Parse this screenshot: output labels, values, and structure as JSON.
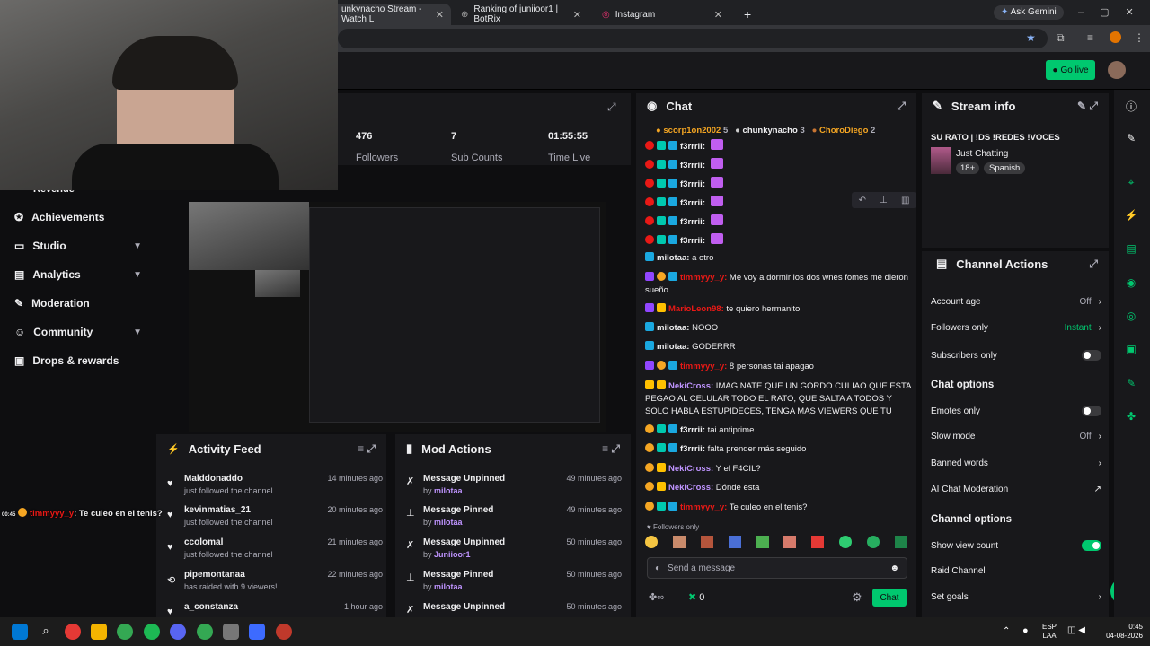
{
  "browser": {
    "tabs": [
      {
        "label": "unkynacho Stream - Watch L"
      },
      {
        "label": "Ranking of juniioor1 | BotRix"
      },
      {
        "label": "Instagram"
      }
    ],
    "new_tab": "+",
    "gemini": "Ask Gemini"
  },
  "topbar": {
    "go_live": "Go live"
  },
  "stats": [
    {
      "value": "476",
      "label": "Followers"
    },
    {
      "value": "7",
      "label": "Sub Counts"
    },
    {
      "value": "01:55:55",
      "label": "Time Live"
    }
  ],
  "sidebar": {
    "partial": "Revenue",
    "items": [
      {
        "label": "Achievements"
      },
      {
        "label": "Studio",
        "chev": "▼"
      },
      {
        "label": "Analytics",
        "chev": "▼"
      },
      {
        "label": "Moderation"
      },
      {
        "label": "Community",
        "chev": "▼"
      },
      {
        "label": "Drops & rewards"
      }
    ]
  },
  "activity": {
    "title": "Activity Feed",
    "items": [
      {
        "name": "Malddonaddo",
        "sub": "just followed the channel",
        "time": "14 minutes ago"
      },
      {
        "name": "kevinmatias_21",
        "sub": "just followed the channel",
        "time": "20 minutes ago"
      },
      {
        "name": "ccolomal",
        "sub": "just followed the channel",
        "time": "21 minutes ago"
      },
      {
        "name": "pipemontanaa",
        "sub": "has raided with 9 viewers!",
        "time": "22 minutes ago"
      },
      {
        "name": "a_constanza",
        "sub": "",
        "time": "1 hour ago"
      }
    ]
  },
  "overlay_chat": {
    "time": "00:45",
    "user": "timmyyy_y",
    "text": ": Te culeo en el tenis?"
  },
  "mod_actions": {
    "title": "Mod Actions",
    "by": "by",
    "items": [
      {
        "action": "Message Unpinned",
        "user": "milotaa",
        "time": "49 minutes ago"
      },
      {
        "action": "Message Pinned",
        "user": "milotaa",
        "time": "49 minutes ago"
      },
      {
        "action": "Message Unpinned",
        "user": "Juniioor1",
        "time": "50 minutes ago"
      },
      {
        "action": "Message Pinned",
        "user": "milotaa",
        "time": "50 minutes ago"
      },
      {
        "action": "Message Unpinned",
        "user": "",
        "time": "50 minutes ago"
      }
    ]
  },
  "chat": {
    "title": "Chat",
    "top_gifters": [
      {
        "name": "scorp1on2002",
        "n": "5"
      },
      {
        "name": "chunkynacho",
        "n": "3"
      },
      {
        "name": "ChoroDiego",
        "n": "2"
      }
    ],
    "messages": [
      {
        "user": "f3rrrii:",
        "text": "",
        "color": "#efeff1"
      },
      {
        "user": "f3rrrii:",
        "text": "",
        "color": "#efeff1"
      },
      {
        "user": "f3rrrii:",
        "text": "",
        "color": "#efeff1"
      },
      {
        "user": "f3rrrii:",
        "text": "",
        "color": "#efeff1"
      },
      {
        "user": "f3rrrii:",
        "text": "",
        "color": "#efeff1"
      },
      {
        "user": "f3rrrii:",
        "text": "",
        "color": "#efeff1"
      },
      {
        "user": "milotaa:",
        "text": " a otro",
        "color": "#efeff1"
      },
      {
        "user": "timmyyy_y:",
        "text": " Me voy a dormir los dos wnes fomes me dieron sueño",
        "color": "#e91916"
      },
      {
        "user": "MarioLeon98:",
        "text": " te quiero hermanito",
        "color": "#e91916"
      },
      {
        "user": "milotaa:",
        "text": " NOOO",
        "color": "#efeff1"
      },
      {
        "user": "milotaa:",
        "text": " GODERRR",
        "color": "#efeff1"
      },
      {
        "user": "timmyyy_y:",
        "text": " 8 personas tai apagao",
        "color": "#e91916"
      },
      {
        "user": "NekiCross:",
        "text": " IMAGINATE QUE UN GORDO CULIAO QUE ESTA PEGAO AL CELULAR TODO EL RATO, QUE SALTA A TODOS Y SOLO HABLA ESTUPIDECES, TENGA MAS VIEWERS QUE TU",
        "color": "#bf94ff"
      },
      {
        "user": "f3rrrii:",
        "text": " tai antiprime",
        "color": "#efeff1"
      },
      {
        "user": "f3rrrii:",
        "text": " falta prender más seguido",
        "color": "#efeff1"
      },
      {
        "user": "NekiCross:",
        "text": " Y el F4CIL?",
        "color": "#bf94ff"
      },
      {
        "user": "NekiCross:",
        "text": " Dónde esta",
        "color": "#bf94ff"
      },
      {
        "user": "timmyyy_y:",
        "text": " Te culeo en el tenis?",
        "color": "#e91916"
      }
    ],
    "followers_only": "Followers only",
    "placeholder": "Send a message",
    "count": "0",
    "send": "Chat"
  },
  "stream_info": {
    "title": "Stream info",
    "stream_title": "SU RATO | !DS !REDES !VOCES",
    "category": "Just Chatting",
    "tags": [
      "18+",
      "Spanish"
    ]
  },
  "channel_actions": {
    "title": "Channel Actions",
    "account_age": {
      "label": "Account age",
      "value": "Off"
    },
    "followers_only": {
      "label": "Followers only",
      "value": "Instant"
    },
    "subscribers_only": {
      "label": "Subscribers only"
    },
    "chat_options_title": "Chat options",
    "emotes_only": {
      "label": "Emotes only"
    },
    "slow_mode": {
      "label": "Slow mode",
      "value": "Off"
    },
    "banned_words": {
      "label": "Banned words"
    },
    "ai_mod": {
      "label": "AI Chat Moderation"
    },
    "channel_options_title": "Channel options",
    "show_view_count": {
      "label": "Show view count",
      "on": true
    },
    "raid_channel": {
      "label": "Raid Channel"
    },
    "set_goals": {
      "label": "Set goals"
    }
  },
  "taskbar": {
    "lang": "ESP",
    "region": "LAA",
    "time": "0:45",
    "date": "04-08-2026"
  },
  "colors": {
    "accent": "#00c86f",
    "bg": "#0e0e10",
    "panel": "#18181b"
  }
}
